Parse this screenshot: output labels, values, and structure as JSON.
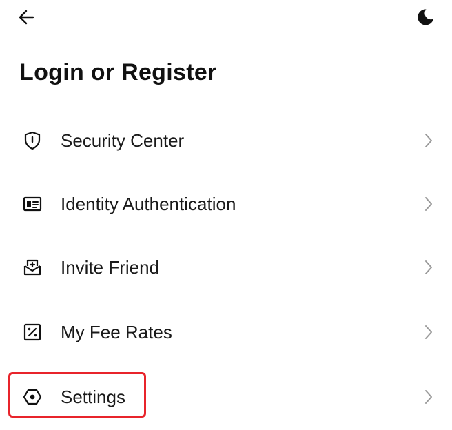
{
  "header": {
    "back_icon": "arrow-left-icon",
    "theme_icon": "moon-icon"
  },
  "page": {
    "title": "Login or Register"
  },
  "menu": {
    "items": [
      {
        "label": "Security Center",
        "icon": "shield-icon"
      },
      {
        "label": "Identity Authentication",
        "icon": "id-card-icon"
      },
      {
        "label": "Invite Friend",
        "icon": "invite-mail-icon"
      },
      {
        "label": "My Fee Rates",
        "icon": "percent-icon"
      },
      {
        "label": "Settings",
        "icon": "hexagon-settings-icon"
      }
    ]
  },
  "annotation": {
    "highlight_color": "#e8242b",
    "highlighted_item": "Settings"
  }
}
